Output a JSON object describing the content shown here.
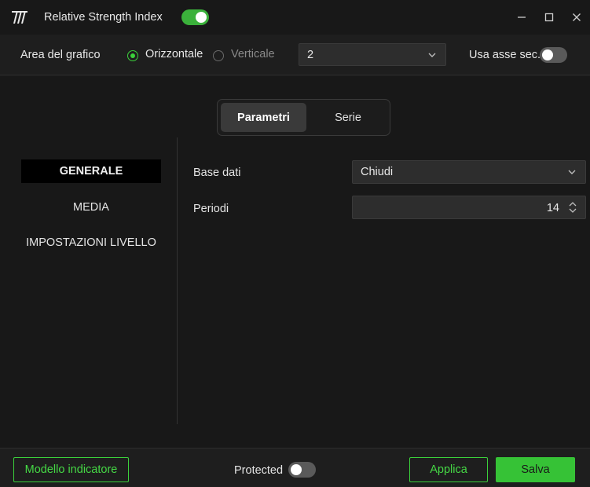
{
  "window": {
    "title": "Relative Strength Index",
    "title_toggle_on": true,
    "controls": {
      "minimize": "minimize-icon",
      "maximize": "maximize-icon",
      "close": "close-icon"
    }
  },
  "toolbar": {
    "area_label": "Area del grafico",
    "orientation": {
      "options": [
        "Orizzontale",
        "Verticale"
      ],
      "selected": "Orizzontale"
    },
    "pane_select_value": "2",
    "secondary_axis_label": "Usa asse sec.",
    "secondary_axis_on": false
  },
  "tabs": {
    "items": [
      "Parametri",
      "Serie"
    ],
    "active": "Parametri"
  },
  "sidebar": {
    "items": [
      "GENERALE",
      "MEDIA",
      "IMPOSTAZIONI LIVELLO"
    ],
    "active": "GENERALE"
  },
  "form": {
    "base_label": "Base dati",
    "base_value": "Chiudi",
    "period_label": "Periodi",
    "period_value": "14"
  },
  "footer": {
    "template_button": "Modello indicatore",
    "protected_label": "Protected",
    "protected_on": false,
    "apply_button": "Applica",
    "save_button": "Salva"
  },
  "colors": {
    "accent": "#3bd13b",
    "background": "#181818",
    "panel": "#2d2d2d"
  }
}
